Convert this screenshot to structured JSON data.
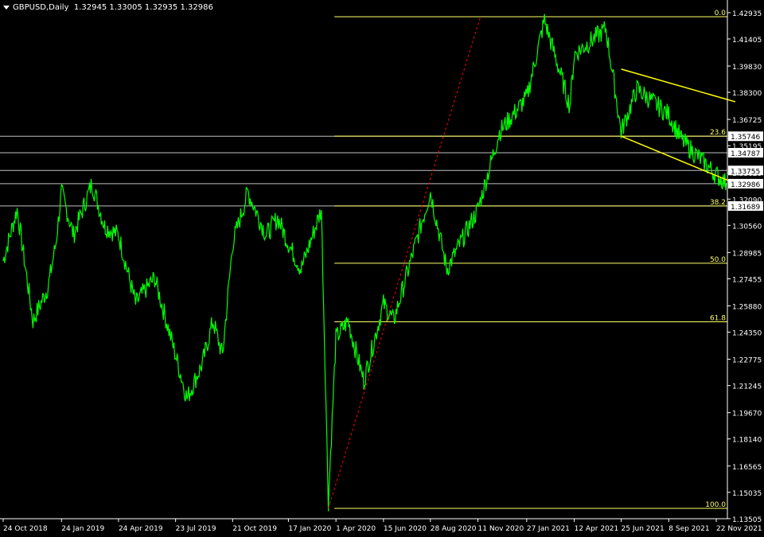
{
  "header": {
    "symbol": "GBPUSD,Daily",
    "ohlc": "1.32945 1.33005 1.32935 1.32986"
  },
  "colors": {
    "background": "#000000",
    "candles": "#00ff00",
    "fib": "#ffff66",
    "trend_channel": "#ffff00",
    "trend_line": "#ff0000",
    "axis_text": "#ffffff",
    "price_box": "#ffffff"
  },
  "chart_data": {
    "type": "line",
    "title": "GBPUSD,Daily",
    "ylim": [
      1.135,
      1.433
    ],
    "y_tick_labels": [
      "1.42935",
      "1.41405",
      "1.39830",
      "1.38300",
      "1.36725",
      "1.35195",
      "1.33620",
      "1.32090",
      "1.30560",
      "1.28985",
      "1.27455",
      "1.25880",
      "1.24350",
      "1.22775",
      "1.21245",
      "1.19670",
      "1.18140",
      "1.16565",
      "1.15035",
      "1.13505"
    ],
    "x_tick_labels": [
      "24 Oct 2018",
      "24 Jan 2019",
      "24 Apr 2019",
      "23 Jul 2019",
      "21 Oct 2019",
      "17 Jan 2020",
      "1 Apr 2020",
      "15 Jun 2020",
      "28 Aug 2020",
      "11 Nov 2020",
      "27 Jan 2021",
      "12 Apr 2021",
      "25 Jun 2021",
      "8 Sep 2021",
      "22 Nov 2021"
    ],
    "price_series": {
      "name": "GBPUSD",
      "x": [
        "24 Oct 2018",
        "15 Nov 2018",
        "10 Dec 2018",
        "28 Dec 2018",
        "3 Jan 2019",
        "15 Jan 2019",
        "24 Jan 2019",
        "12 Feb 2019",
        "13 Mar 2019",
        "2 Apr 2019",
        "24 Apr 2019",
        "21 May 2019",
        "5 Jun 2019",
        "20 Jun 2019",
        "10 Jul 2019",
        "23 Jul 2019",
        "10 Aug 2019",
        "3 Sep 2019",
        "20 Sep 2019",
        "5 Oct 2019",
        "21 Oct 2019",
        "14 Nov 2019",
        "13 Dec 2019",
        "31 Dec 2019",
        "17 Jan 2020",
        "6 Feb 2020",
        "9 Mar 2020",
        "20 Mar 2020",
        "1 Apr 2020",
        "20 Apr 2020",
        "15 May 2020",
        "15 Jun 2020",
        "1 Jul 2020",
        "28 Aug 2020",
        "23 Sep 2020",
        "11 Nov 2020",
        "15 Dec 2020",
        "27 Jan 2021",
        "24 Feb 2021",
        "5 Apr 2021",
        "12 Apr 2021",
        "1 Jun 2021",
        "25 Jun 2021",
        "20 Jul 2021",
        "8 Sep 2021",
        "29 Sep 2021",
        "22 Nov 2021",
        "8 Dec 2021"
      ],
      "values": [
        1.285,
        1.315,
        1.25,
        1.265,
        1.27,
        1.295,
        1.325,
        1.3,
        1.33,
        1.305,
        1.3,
        1.26,
        1.268,
        1.275,
        1.248,
        1.23,
        1.205,
        1.225,
        1.25,
        1.23,
        1.295,
        1.325,
        1.3,
        1.31,
        1.295,
        1.28,
        1.315,
        1.145,
        1.24,
        1.25,
        1.215,
        1.26,
        1.25,
        1.325,
        1.28,
        1.315,
        1.36,
        1.38,
        1.425,
        1.375,
        1.405,
        1.42,
        1.36,
        1.385,
        1.37,
        1.355,
        1.335,
        1.3299
      ]
    },
    "fib_levels": [
      {
        "label": "0.0",
        "price": 1.427
      },
      {
        "label": "23.6",
        "price": 1.3575
      },
      {
        "label": "38.2",
        "price": 1.3169
      },
      {
        "label": "50.0",
        "price": 1.2836
      },
      {
        "label": "61.8",
        "price": 1.2495
      },
      {
        "label": "100.0",
        "price": 1.141
      }
    ],
    "price_boxes": [
      "1.35746",
      "1.34787",
      "1.33755",
      "1.32986",
      "1.31689"
    ],
    "horizontal_lines": [
      1.35746,
      1.34787,
      1.33755,
      1.32986,
      1.31689
    ],
    "trend_line": {
      "from": {
        "x": "20 Mar 2020",
        "y": 1.141
      },
      "to": {
        "x": "15 Nov 2020",
        "y": 1.427
      }
    },
    "channel": [
      {
        "from": {
          "x": "25 Jun 2021",
          "y": 1.3965
        },
        "to": {
          "x": "22 Dec 2021",
          "y": 1.3775
        }
      },
      {
        "from": {
          "x": "25 Jun 2021",
          "y": 1.3575
        },
        "to": {
          "x": "22 Dec 2021",
          "y": 1.33
        }
      }
    ]
  }
}
